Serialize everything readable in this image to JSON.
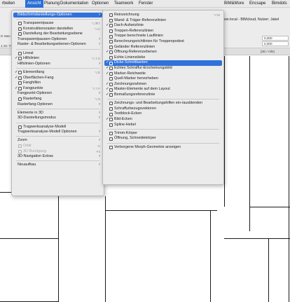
{
  "menubar": {
    "items": [
      "rbeiten",
      "Ansicht",
      "Planung",
      "Dokumentation",
      "Optionen",
      "Teamwork",
      "Fenster",
      "BIM&More",
      "Encsape",
      "Bimdots"
    ]
  },
  "toolbar": {
    "window_title": "rver.local - BIMcloud, Nutzer: Jakel",
    "coord_a": "0,000",
    "coord_b": "0,000",
    "view_label": "[3D / Alle]",
    "left_tag_a": "D Wan",
    "left_tag_b": "1:16: Tr"
  },
  "menu_main": {
    "items": [
      {
        "label": "Bildschirmdarstellungs-Optionen",
        "arrow": "›",
        "highlighted": true
      },
      {
        "label": "Transparentpause",
        "icon": "trace-icon",
        "shortcut": "⌥⌘T"
      },
      {
        "label": "Konstruktionsraster darstellen",
        "icon": "grid-icon",
        "shortcut": "⌥G"
      },
      {
        "label": "Darstellung der Bearbeitungsebene",
        "icon": "plane-icon"
      },
      {
        "label": "Transparentpausen-Optionen",
        "arrow": "›"
      },
      {
        "label": "Raster- & Bearbeitungsebenen-Optionen",
        "arrow": "›"
      },
      {
        "label": "Lineal",
        "icon": "ruler-icon"
      },
      {
        "label": "Hilfslinien",
        "check": "✓",
        "icon": "guides-icon",
        "shortcut": "⌥⇧G"
      },
      {
        "label": "Hilfslinien-Optionen",
        "arrow": "›"
      },
      {
        "label": "Elementfang",
        "check": "✓",
        "icon": "snap-icon",
        "shortcut": "⌥E"
      },
      {
        "label": "Oberflächen-Fang",
        "check": "✓",
        "icon": "surface-icon"
      },
      {
        "label": "Fanghilfen",
        "icon": "snaphelp-icon"
      },
      {
        "label": "Fangpunkte",
        "check": "✓",
        "icon": "points-icon",
        "shortcut": "⌥⇧F"
      },
      {
        "label": "Fangpunkt-Optionen",
        "arrow": "›"
      },
      {
        "label": "Rasterfang",
        "icon": "gridsnap-icon",
        "shortcut": "⌥S"
      },
      {
        "label": "Rasterfang-Optionen",
        "arrow": "›"
      },
      {
        "label": "Elemente in 3D",
        "arrow": "›"
      },
      {
        "label": "3D-Darstellungsmodus",
        "arrow": "›"
      },
      {
        "label": "Tragwerksanalyse-Modell",
        "icon": "structure-icon"
      },
      {
        "label": "Tragwerksanalyse-Modell Optionen",
        "arrow": "›"
      },
      {
        "label": "Zoom",
        "arrow": "›"
      },
      {
        "label": "Orbit",
        "icon": "orbit-icon",
        "shortcut": "O",
        "disabled": true
      },
      {
        "label": "3D Rundgang",
        "icon": "walk-icon",
        "shortcut": "F3",
        "disabled": true
      },
      {
        "label": "3D-Navigation Extras",
        "arrow": "›"
      },
      {
        "label": "Neuaufbau",
        "arrow": "›"
      }
    ]
  },
  "menu_sub": {
    "items": [
      {
        "label": "Reinzeichnung",
        "icon": "clean-icon",
        "shortcut": "⌥W"
      },
      {
        "label": "Wand- & Träger-Referenzlinien",
        "icon": "wallref-icon"
      },
      {
        "label": "Dach-Aufsetzlinie",
        "check": "✓",
        "icon": "roof-icon"
      },
      {
        "label": "Treppen-Referenzlinien",
        "icon": "stair-icon"
      },
      {
        "label": "Treppe berechnete Lauflinien",
        "icon": "stairwalk-icon"
      },
      {
        "label": "Berechnungsrichtlinien für Treppenpodest",
        "icon": "landing-icon"
      },
      {
        "label": "Geländer Referenzlinien",
        "icon": "railing-icon"
      },
      {
        "label": "Öffnung-Referenzebenen",
        "check": "✓",
        "icon": "opening-icon"
      },
      {
        "label": "Echte Linienstärke",
        "icon": "lineweight-icon"
      },
      {
        "label": "Dicke Schnittkanten",
        "check": "✓",
        "icon": "thickcut-icon",
        "highlighted": true
      },
      {
        "label": "Echtes Schraffur-Erscheinungsbild",
        "check": "✓",
        "icon": "hatch-icon"
      },
      {
        "label": "Marker-Reichweite",
        "check": "✓",
        "icon": "marker-icon"
      },
      {
        "label": "Quell-Marker hervorheben",
        "icon": "sourcemarker-icon"
      },
      {
        "label": "Zeichnungsrahmen",
        "check": "✓",
        "icon": "frame-icon"
      },
      {
        "label": "Master-Elemente auf dem Layout",
        "check": "✓",
        "icon": "master-icon"
      },
      {
        "label": "Bemaßungsreferenzlinie",
        "check": "✓",
        "icon": "dimension-icon"
      },
      {
        "label": "Zeichnungs- und Bearbeitungshilfen ein-/ausblenden",
        "icon": "aids-icon"
      },
      {
        "label": "Schraffurbezugsvektoren",
        "icon": "vector-icon"
      },
      {
        "label": "Textblock-Ecken",
        "icon": "textblock-icon"
      },
      {
        "label": "Bild-Ecken",
        "check": "✓",
        "icon": "image-icon"
      },
      {
        "label": "Spline-Hebel",
        "icon": "spline-icon"
      },
      {
        "label": "Trimm-Körper",
        "icon": "trim-icon"
      },
      {
        "label": "Öffnung, Schneidekörper",
        "icon": "cutbody-icon"
      },
      {
        "label": "Verborgene Morph-Geometrie anzeigen",
        "icon": "morph-icon"
      }
    ]
  }
}
